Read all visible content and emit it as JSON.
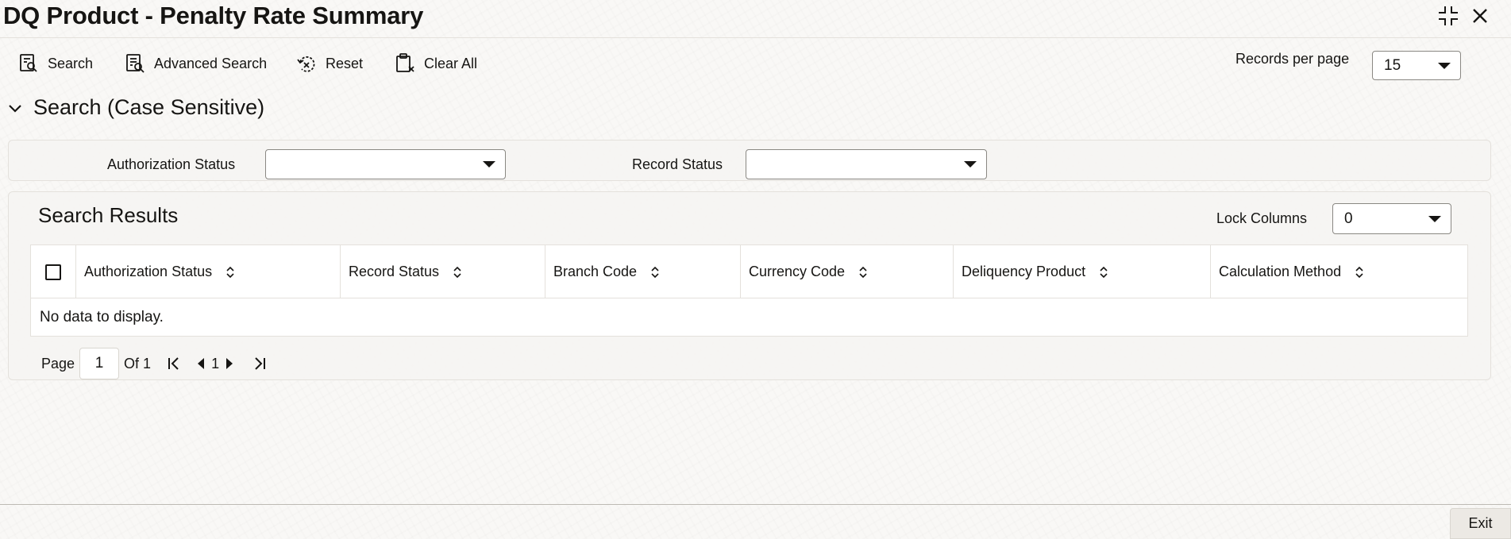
{
  "window": {
    "title": "DQ Product - Penalty Rate Summary"
  },
  "toolbar": {
    "search_label": "Search",
    "advanced_search_label": "Advanced Search",
    "reset_label": "Reset",
    "clear_all_label": "Clear All",
    "records_per_page_label": "Records per page",
    "records_per_page_value": "15"
  },
  "search_section": {
    "title": "Search (Case Sensitive)",
    "authorization_status_label": "Authorization Status",
    "authorization_status_value": "",
    "record_status_label": "Record Status",
    "record_status_value": ""
  },
  "results": {
    "title": "Search Results",
    "lock_columns_label": "Lock Columns",
    "lock_columns_value": "0",
    "columns": [
      "Authorization Status",
      "Record Status",
      "Branch Code",
      "Currency Code",
      "Deliquency Product",
      "Calculation Method"
    ],
    "rows": [],
    "empty_message": "No data to display."
  },
  "pagination": {
    "page_label": "Page",
    "current_page": "1",
    "of_label": "Of 1",
    "page_number": "1"
  },
  "footer": {
    "exit_label": "Exit"
  },
  "icons": {
    "minimize": "minimize-icon",
    "close": "close-icon",
    "search": "search-icon",
    "advanced_search": "advanced-search-icon",
    "reset": "reset-icon",
    "clear_all": "clear-all-icon",
    "collapse": "chevron-down-icon",
    "sort": "sort-icon",
    "first": "first-page-icon",
    "prev": "prev-page-icon",
    "next": "next-page-icon",
    "last": "last-page-icon"
  }
}
